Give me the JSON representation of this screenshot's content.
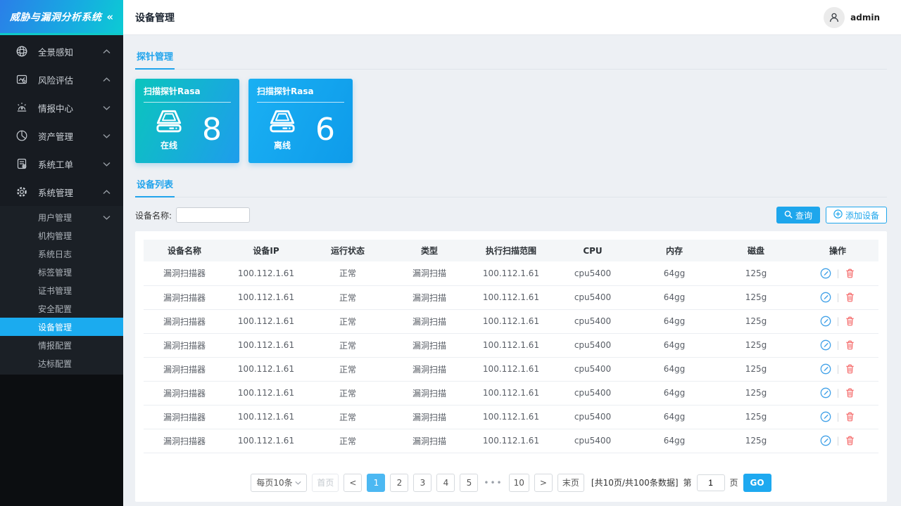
{
  "app": {
    "logo_title": "威胁与漏洞分析系统",
    "collapse_glyph": "«"
  },
  "header": {
    "title": "设备管理",
    "username": "admin"
  },
  "sidebar": {
    "items": [
      {
        "label": "全景感知",
        "icon": "globe-icon",
        "chevron": "up"
      },
      {
        "label": "风险评估",
        "icon": "risk-chart-icon",
        "chevron": "up"
      },
      {
        "label": "情报中心",
        "icon": "alarm-icon",
        "chevron": "down"
      },
      {
        "label": "资产管理",
        "icon": "pie-chart-icon",
        "chevron": "down"
      },
      {
        "label": "系统工单",
        "icon": "work-order-icon",
        "chevron": "down"
      },
      {
        "label": "系统管理",
        "icon": "gear-icon",
        "chevron": "up"
      }
    ],
    "submenu": [
      {
        "label": "用户管理",
        "chevron": "down",
        "active": false
      },
      {
        "label": "机构管理",
        "active": false
      },
      {
        "label": "系统日志",
        "active": false
      },
      {
        "label": "标签管理",
        "active": false
      },
      {
        "label": "证书管理",
        "active": false
      },
      {
        "label": "安全配置",
        "active": false
      },
      {
        "label": "设备管理",
        "active": true
      },
      {
        "label": "情报配置",
        "active": false
      },
      {
        "label": "达标配置",
        "active": false
      }
    ]
  },
  "probe_section": {
    "title": "探针管理",
    "cards": [
      {
        "title": "扫描探针Rasa",
        "status": "在线",
        "count": "8",
        "gradient": [
          "#0bc5bd",
          "#1e9dec"
        ]
      },
      {
        "title": "扫描探针Rasa",
        "status": "离线",
        "count": "6",
        "gradient": [
          "#1ab0f3",
          "#0e9bea"
        ]
      }
    ]
  },
  "device_section": {
    "title": "设备列表",
    "filter": {
      "label": "设备名称:",
      "value": ""
    },
    "buttons": {
      "search": "查询",
      "add": "添加设备"
    },
    "table": {
      "columns": [
        "设备名称",
        "设备IP",
        "运行状态",
        "类型",
        "执行扫描范围",
        "CPU",
        "内存",
        "磁盘",
        "操作"
      ],
      "rows": [
        {
          "name": "漏洞扫描器",
          "ip": "100.112.1.61",
          "status": "正常",
          "type": "漏洞扫描",
          "scan_range": "100.112.1.61",
          "cpu": "cpu5400",
          "memory": "64gg",
          "disk": "125g"
        },
        {
          "name": "漏洞扫描器",
          "ip": "100.112.1.61",
          "status": "正常",
          "type": "漏洞扫描",
          "scan_range": "100.112.1.61",
          "cpu": "cpu5400",
          "memory": "64gg",
          "disk": "125g"
        },
        {
          "name": "漏洞扫描器",
          "ip": "100.112.1.61",
          "status": "正常",
          "type": "漏洞扫描",
          "scan_range": "100.112.1.61",
          "cpu": "cpu5400",
          "memory": "64gg",
          "disk": "125g"
        },
        {
          "name": "漏洞扫描器",
          "ip": "100.112.1.61",
          "status": "正常",
          "type": "漏洞扫描",
          "scan_range": "100.112.1.61",
          "cpu": "cpu5400",
          "memory": "64gg",
          "disk": "125g"
        },
        {
          "name": "漏洞扫描器",
          "ip": "100.112.1.61",
          "status": "正常",
          "type": "漏洞扫描",
          "scan_range": "100.112.1.61",
          "cpu": "cpu5400",
          "memory": "64gg",
          "disk": "125g"
        },
        {
          "name": "漏洞扫描器",
          "ip": "100.112.1.61",
          "status": "正常",
          "type": "漏洞扫描",
          "scan_range": "100.112.1.61",
          "cpu": "cpu5400",
          "memory": "64gg",
          "disk": "125g"
        },
        {
          "name": "漏洞扫描器",
          "ip": "100.112.1.61",
          "status": "正常",
          "type": "漏洞扫描",
          "scan_range": "100.112.1.61",
          "cpu": "cpu5400",
          "memory": "64gg",
          "disk": "125g"
        },
        {
          "name": "漏洞扫描器",
          "ip": "100.112.1.61",
          "status": "正常",
          "type": "漏洞扫描",
          "scan_range": "100.112.1.61",
          "cpu": "cpu5400",
          "memory": "64gg",
          "disk": "125g"
        }
      ]
    },
    "pagination": {
      "page_size_label": "每页10条",
      "first_label": "首页",
      "prev_glyph": "<",
      "pages": [
        "1",
        "2",
        "3",
        "4",
        "5"
      ],
      "active_page": "1",
      "ellipsis": "•••",
      "tail_page": "10",
      "next_glyph": ">",
      "last_label": "末页",
      "summary": "[共10页/共100条数据]",
      "jump_prefix": "第",
      "jump_value": "1",
      "jump_suffix": "页",
      "go_label": "GO"
    }
  },
  "colors": {
    "primary": "#1ea6ec",
    "active_page": "#4cb8f2",
    "edit_icon": "#41a1e8",
    "delete_icon": "#f56c6c"
  }
}
